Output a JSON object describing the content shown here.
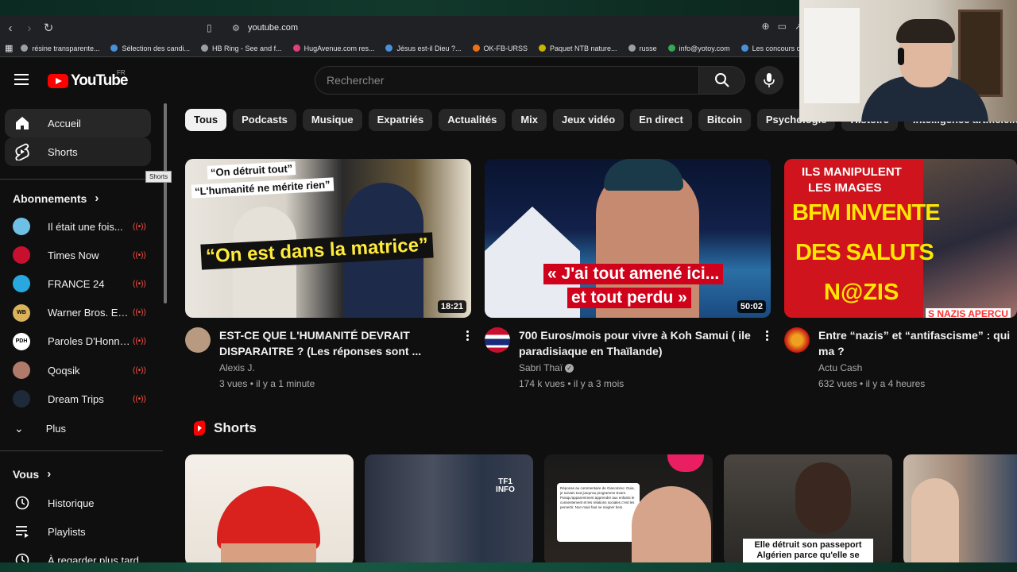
{
  "browser": {
    "url": "youtube.com",
    "bookmarks": [
      {
        "label": "résine transparente...",
        "color": "#9aa0a6"
      },
      {
        "label": "Sélection des candi...",
        "color": "#4a90d9"
      },
      {
        "label": "HB Ring - See and f...",
        "color": "#9aa0a6"
      },
      {
        "label": "HugAvenue.com res...",
        "color": "#e0407a"
      },
      {
        "label": "Jésus est-il Dieu ?...",
        "color": "#4a90d9"
      },
      {
        "label": "OK-FB-URSS",
        "color": "#e8711a"
      },
      {
        "label": "Paquet NTB nature...",
        "color": "#c8b400"
      },
      {
        "label": "russe",
        "color": "#9aa0a6"
      },
      {
        "label": "info@yotoy.com",
        "color": "#34a853"
      },
      {
        "label": "Les concours d'au",
        "color": "#4a90d9"
      }
    ]
  },
  "header": {
    "logo_text": "YouTube",
    "country": "FR",
    "search_placeholder": "Rechercher"
  },
  "sidebar": {
    "main": [
      {
        "label": "Accueil",
        "icon": "home-icon"
      },
      {
        "label": "Shorts",
        "icon": "shorts-icon"
      }
    ],
    "tooltip": "Shorts",
    "subscriptions_title": "Abonnements",
    "subscriptions": [
      {
        "name": "Il était une fois...",
        "avatar_color": "#6ec1e4",
        "abbr": ""
      },
      {
        "name": "Times Now",
        "avatar_color": "#c8102e",
        "abbr": ""
      },
      {
        "name": "FRANCE 24",
        "avatar_color": "#29a8e0",
        "abbr": ""
      },
      {
        "name": "Warner Bros. Ent...",
        "avatar_color": "#d9b25a",
        "abbr": "WB"
      },
      {
        "name": "Paroles D'Honneur",
        "avatar_color": "#ffffff",
        "abbr": "PDH"
      },
      {
        "name": "Qoqsik",
        "avatar_color": "#b07a6a",
        "abbr": ""
      },
      {
        "name": "Dream Trips",
        "avatar_color": "#1e2a3a",
        "abbr": ""
      }
    ],
    "more_label": "Plus",
    "you_title": "Vous",
    "you_items": [
      {
        "label": "Historique",
        "icon": "history-icon"
      },
      {
        "label": "Playlists",
        "icon": "playlists-icon"
      },
      {
        "label": "À regarder plus tard",
        "icon": "watch-later-icon"
      }
    ]
  },
  "chips": [
    "Tous",
    "Podcasts",
    "Musique",
    "Expatriés",
    "Actualités",
    "Mix",
    "Jeux vidéo",
    "En direct",
    "Bitcoin",
    "Psychologie",
    "Histoire",
    "Intelligence artificielle"
  ],
  "videos": [
    {
      "title": "EST-CE QUE L'HUMANITÉ DEVRAIT DISPARAITRE ? (Les réponses sont ...",
      "channel": "Alexis J.",
      "stats": "3 vues • il y a 1 minute",
      "duration": "18:21",
      "verified": false,
      "thumb_lines": [
        "“On détruit tout”",
        "“L'humanité ne mérite rien”",
        "“On est dans la matrice”"
      ]
    },
    {
      "title": "700 Euros/mois pour vivre à Koh Samui ( ile paradisiaque en Thaïlande)",
      "channel": "Sabri Thaï",
      "stats": "174 k vues • il y a 3 mois",
      "duration": "50:02",
      "verified": true,
      "thumb_lines": [
        "« J'ai tout amené ici...",
        "et tout perdu »"
      ]
    },
    {
      "title": "Entre “nazis” et “antifascisme” : qui ma ?",
      "channel": "Actu Cash",
      "stats": "632 vues • il y a 4 heures",
      "duration": "",
      "verified": false,
      "thumb_lines": [
        "ILS MANIPULENT",
        "LES IMAGES",
        "BFM INVENTE",
        "DES SALUTS",
        "N@ZIS",
        "S NAZIS APERCU"
      ]
    }
  ],
  "shorts": {
    "title": "Shorts",
    "items": [
      {
        "caption": ""
      },
      {
        "caption": "TF1 INFO"
      },
      {
        "caption": "Réponse au commentaire de Giacomino: Ouia, je suivais tout jusqu'au programme Evars. Puisqu'apparemment apprendre aux enfants le consentement et les relations sociales c'est les pervertir. Non mais faut se soigner hein."
      },
      {
        "caption": "Elle détruit son passeport Algérien parce qu'elle se"
      },
      {
        "caption": ""
      }
    ]
  }
}
